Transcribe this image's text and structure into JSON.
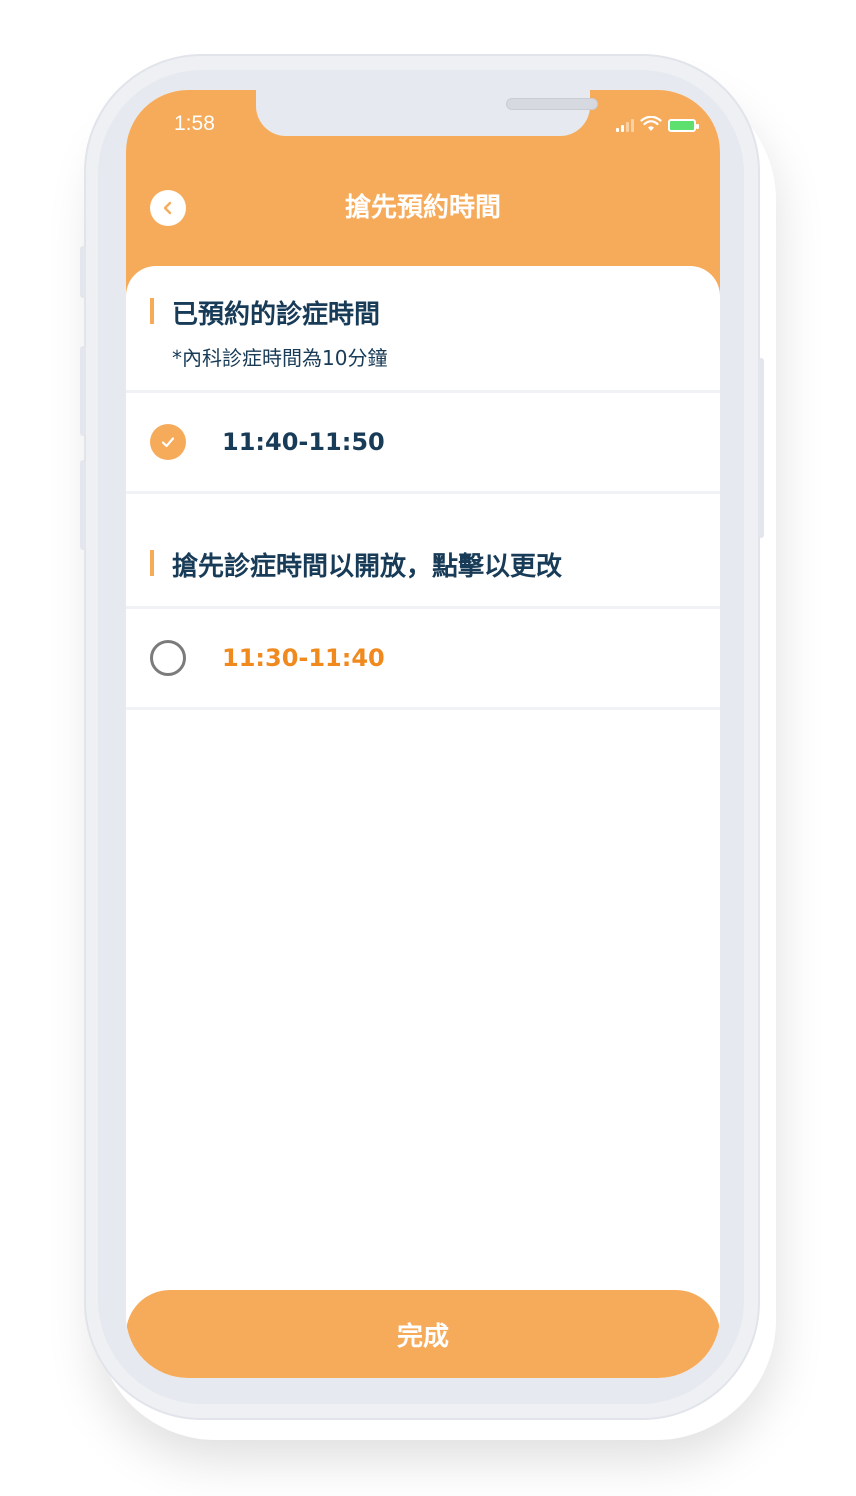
{
  "status_bar": {
    "time": "1:58"
  },
  "header": {
    "title": "搶先預約時間",
    "back_icon": "chevron-left-icon"
  },
  "booked_section": {
    "title": "已預約的診症時間",
    "note": "*內科診症時間為10分鐘",
    "slots": [
      {
        "time": "11:40-11:50",
        "selected": true
      }
    ]
  },
  "open_section": {
    "title": "搶先診症時間以開放，點擊以更改",
    "slots": [
      {
        "time": "11:30-11:40",
        "selected": false
      }
    ]
  },
  "footer": {
    "done_label": "完成"
  },
  "colors": {
    "accent": "#f6ab5b",
    "text_dark": "#183b57",
    "text_orange": "#f08a1e",
    "divider": "#f0f2f5"
  }
}
